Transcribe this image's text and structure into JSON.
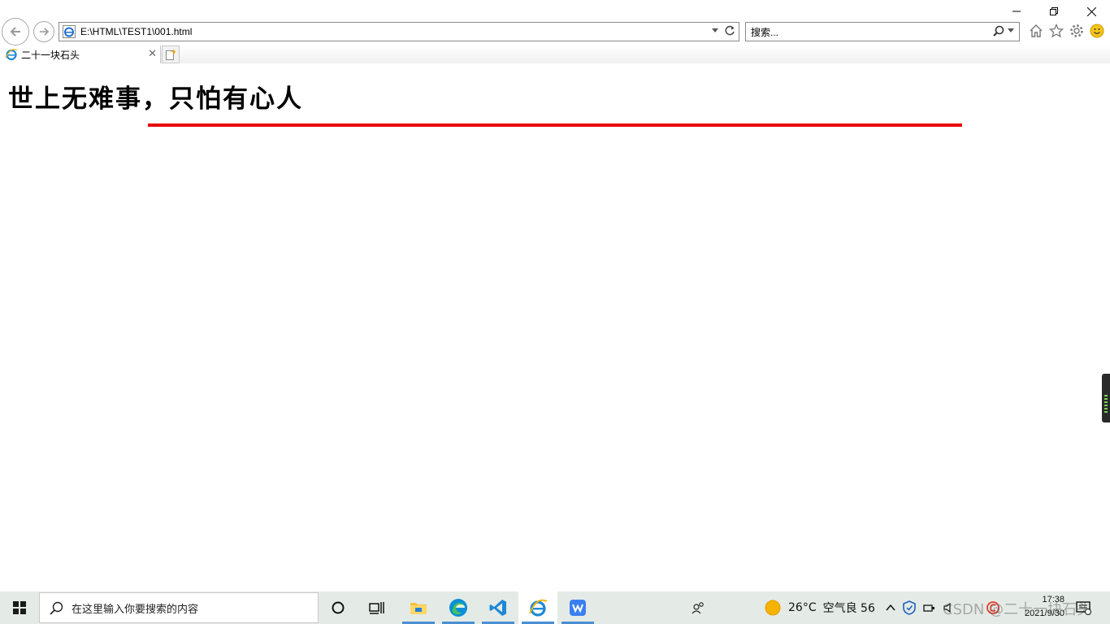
{
  "browser": {
    "address": "E:\\HTML\\TEST1\\001.html",
    "search_placeholder": "搜索...",
    "tab_title": "二十一块石头"
  },
  "page": {
    "heading": "世上无难事，只怕有心人",
    "rule_color": "#e60000"
  },
  "taskbar": {
    "search_placeholder": "在这里输入你要搜索的内容",
    "weather": "26°C",
    "air_quality": "空气良 56",
    "time": "17:38",
    "date": "2021/9/30",
    "watermark": "CSDN @二十一块石头",
    "pinned": [
      "cortana-icon",
      "task-view-icon",
      "file-explorer-icon",
      "edge-icon",
      "vscode-icon",
      "internet-explorer-icon",
      "wps-icon"
    ]
  }
}
